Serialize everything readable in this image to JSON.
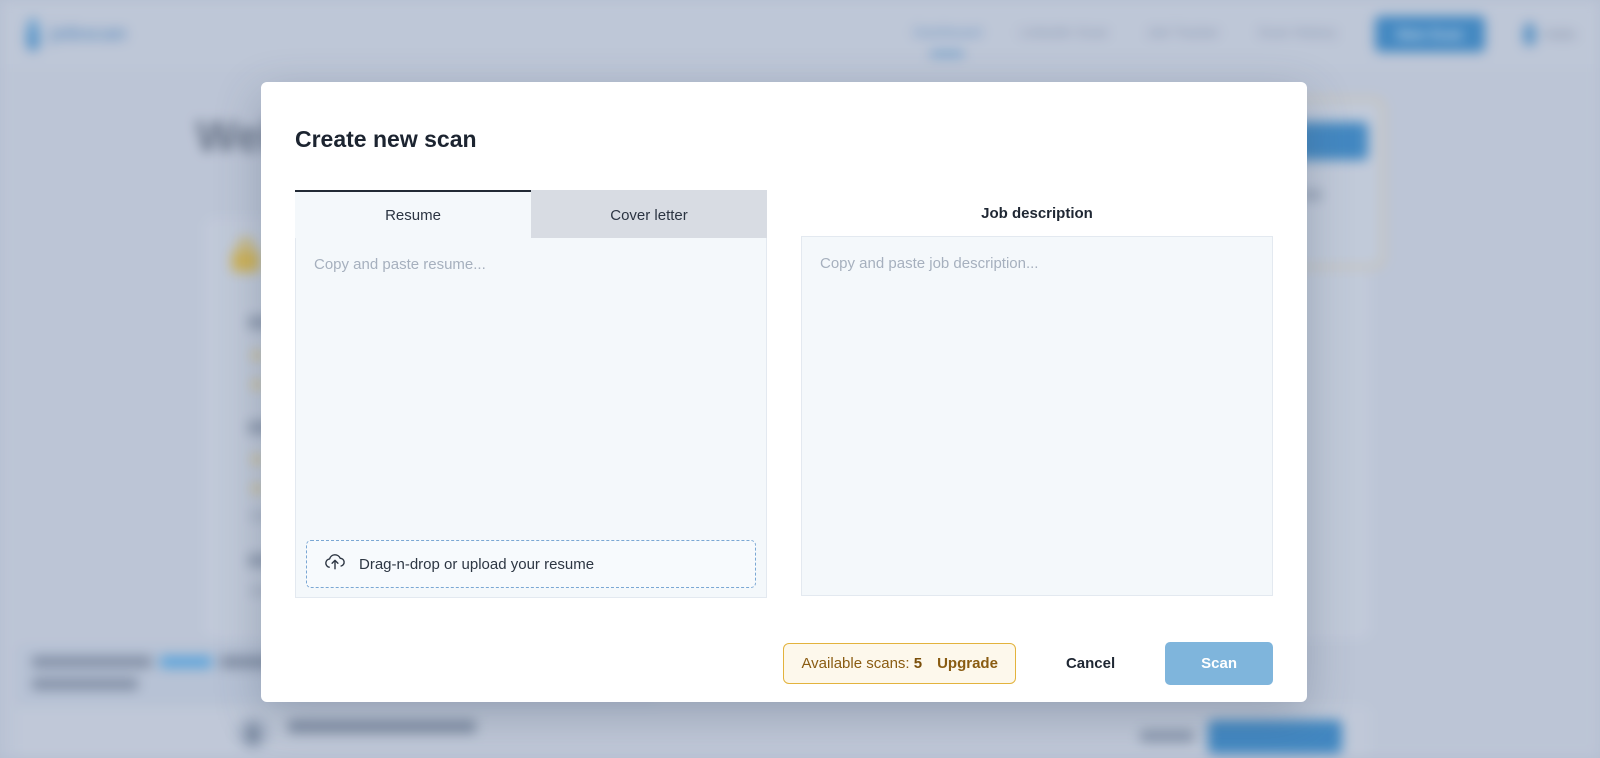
{
  "background": {
    "logo": {
      "text": "jobscan",
      "icon": "droplet-logo-icon"
    },
    "nav": [
      {
        "label": "Dashboard",
        "active": true
      },
      {
        "label": "LinkedIn Scan",
        "active": false
      },
      {
        "label": "Job Tracker",
        "active": false
      },
      {
        "label": "Scan History",
        "active": false
      }
    ],
    "new_scan_button": "New Scan",
    "user_menu": "Hello",
    "welcome_heading": "Welcome",
    "notice_text": "Please complete your profile for personalized recommendations.",
    "notice_link": "profile",
    "bottom_card_text": "Help us get to know you",
    "bottom_card_dismiss": "Dismiss",
    "bottom_card_button": "Complete Profile"
  },
  "modal": {
    "title": "Create new scan",
    "tabs": [
      {
        "id": "resume",
        "label": "Resume",
        "active": true
      },
      {
        "id": "cover-letter",
        "label": "Cover letter",
        "active": false
      }
    ],
    "resume": {
      "value": "",
      "placeholder": "Copy and paste resume...",
      "dropzone_label": "Drag-n-drop or upload your resume",
      "dropzone_icon": "cloud-upload-icon"
    },
    "job_description": {
      "title": "Job description",
      "value": "",
      "placeholder": "Copy and paste job description..."
    },
    "actions": {
      "scans_label": "Available scans:",
      "scans_count": "5",
      "upgrade_label": "Upgrade",
      "cancel_label": "Cancel",
      "scan_label": "Scan"
    }
  },
  "colors": {
    "overlay": "#b9c3d4",
    "accent_blue": "#2f81c2",
    "scan_button": "#7fb5dc",
    "badge_border": "#e3b33d",
    "badge_bg": "#fdf8ec",
    "badge_text": "#8a5c12",
    "tab_active_bg": "#f4f8fb",
    "tab_inactive_bg": "#d8dce3"
  }
}
